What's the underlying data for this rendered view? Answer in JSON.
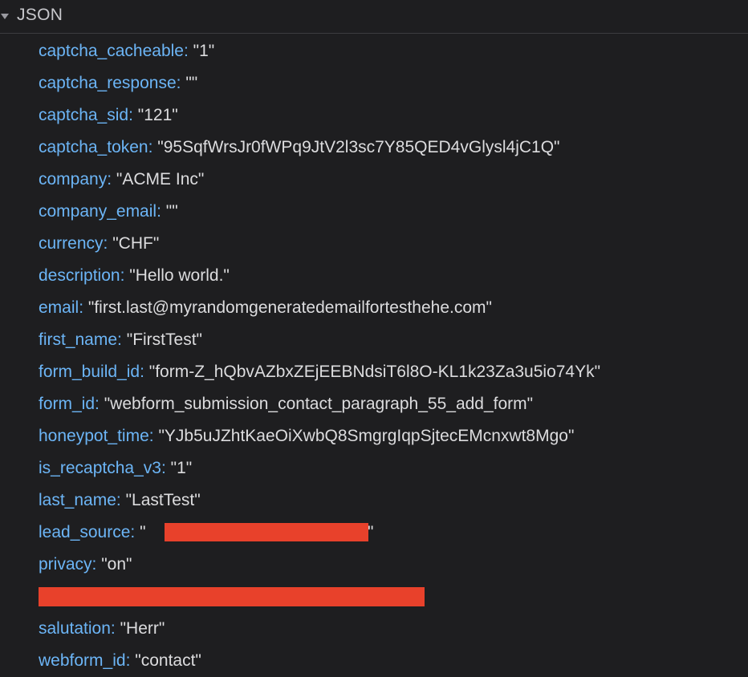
{
  "header": {
    "title": "JSON",
    "expanded": true
  },
  "rows": [
    {
      "key": "captcha_cacheable",
      "value": "\"1\""
    },
    {
      "key": "captcha_response",
      "value": "\"\""
    },
    {
      "key": "captcha_sid",
      "value": "\"121\""
    },
    {
      "key": "captcha_token",
      "value": "\"95SqfWrsJr0fWPq9JtV2l3sc7Y85QED4vGlysl4jC1Q\""
    },
    {
      "key": "company",
      "value": "\"ACME Inc\""
    },
    {
      "key": "company_email",
      "value": "\"\""
    },
    {
      "key": "currency",
      "value": "\"CHF\""
    },
    {
      "key": "description",
      "value": "\"Hello world.\""
    },
    {
      "key": "email",
      "value": "\"first.last@myrandomgeneratedemailfortesthehe.com\""
    },
    {
      "key": "first_name",
      "value": "\"FirstTest\""
    },
    {
      "key": "form_build_id",
      "value": "\"form-Z_hQbvAZbxZEjEEBNdsiT6l8O-KL1k23Za3u5io74Yk\""
    },
    {
      "key": "form_id",
      "value": "\"webform_submission_contact_paragraph_55_add_form\""
    },
    {
      "key": "honeypot_time",
      "value": "\"YJb5uJZhtKaeOiXwbQ8SmgrgIqpSjtecEMcnxwt8Mgo\""
    },
    {
      "key": "is_recaptcha_v3",
      "value": "\"1\""
    },
    {
      "key": "last_name",
      "value": "\"LastTest\""
    },
    {
      "key": "lead_source",
      "value_open": "\"",
      "value_close": "\""
    },
    {
      "key": "privacy",
      "value": "\"on\""
    },
    {
      "key": "salutation",
      "value": "\"Herr\""
    },
    {
      "key": "webform_id",
      "value": "\"contact\""
    }
  ],
  "colors": {
    "background": "#1e1e20",
    "key": "#6cb5f6",
    "value": "#dcdcde",
    "redaction": "#e8412b"
  },
  "icons": {
    "disclosure": "triangle-down-icon"
  }
}
